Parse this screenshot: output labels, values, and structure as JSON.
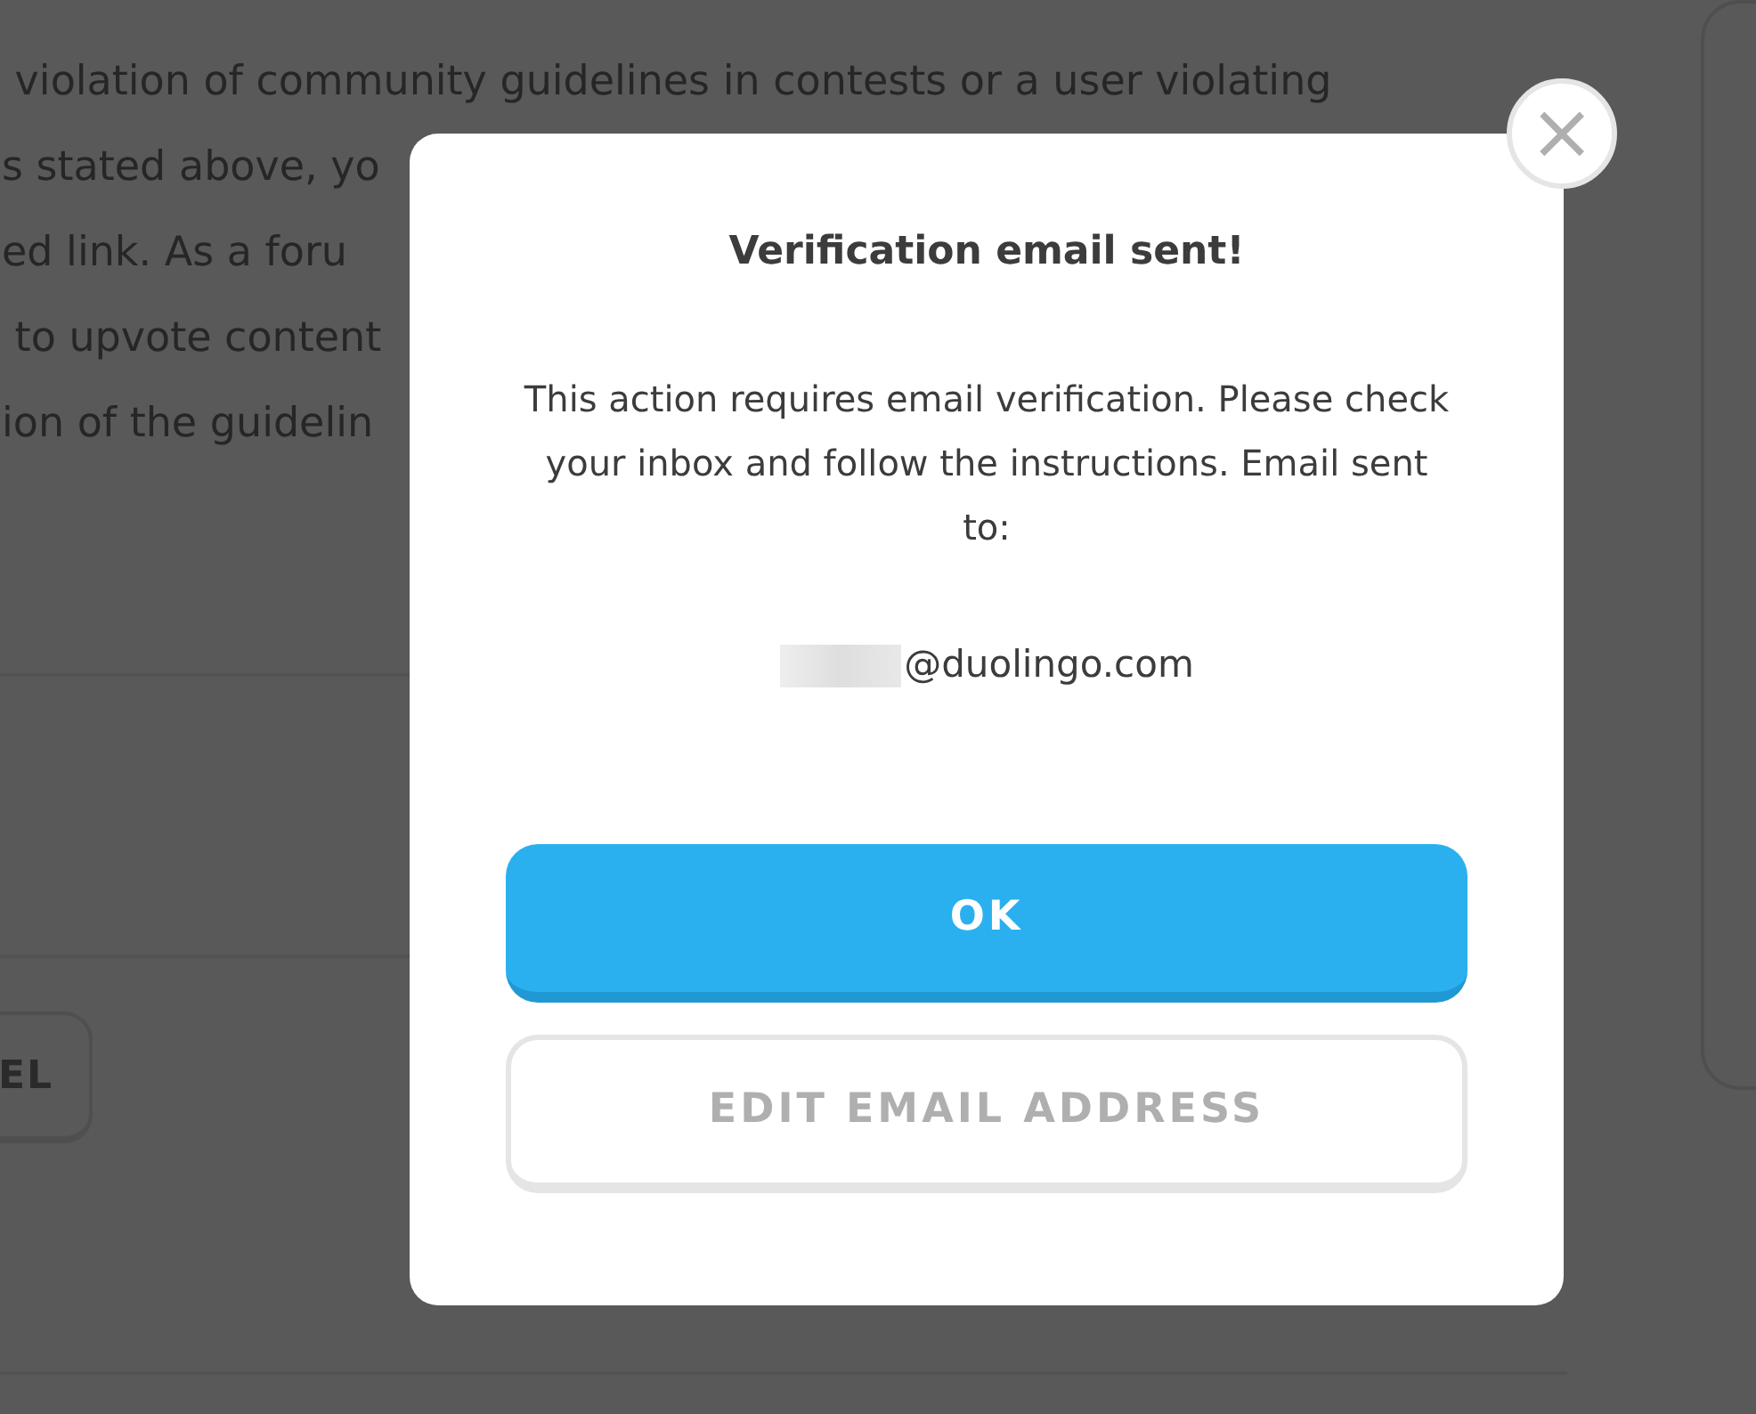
{
  "background": {
    "text_lines": [
      " violation of community guidelines in contests or a user violating",
      "s stated above, yo",
      "ed link. As a foru",
      " to upvote content",
      "ion of the guidelin"
    ],
    "cancel_button": "EL"
  },
  "dialog": {
    "title": "Verification email sent!",
    "message": "This action requires email verification. Please check your inbox and follow the instructions. Email sent to:",
    "email": {
      "redacted": true,
      "domain": "@duolingo.com"
    },
    "buttons": [
      {
        "kind": "primary",
        "label": "OK"
      },
      {
        "kind": "secondary",
        "label": "EDIT EMAIL ADDRESS"
      }
    ],
    "close": "×"
  }
}
